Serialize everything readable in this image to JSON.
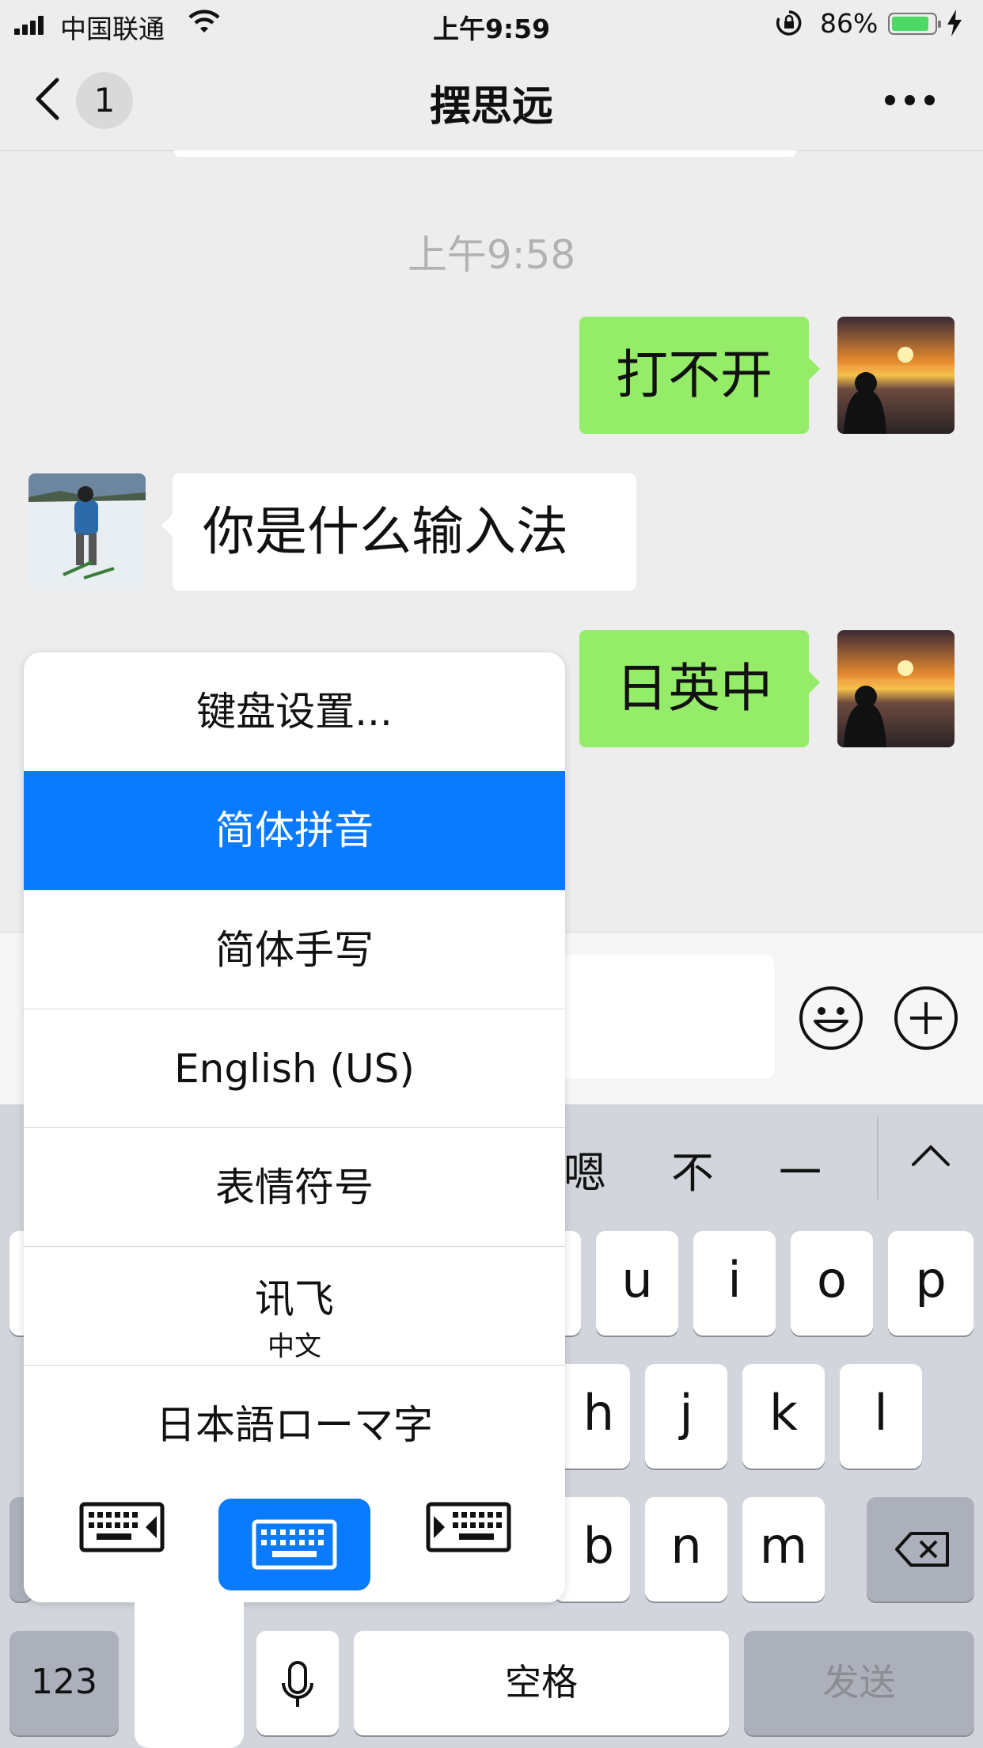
{
  "status_bar": {
    "carrier": "中国联通",
    "time": "上午9:59",
    "battery_percent": "86%",
    "battery_level": 0.86,
    "accent_green": "#4cd964"
  },
  "nav": {
    "back_icon": "chevron-left-icon",
    "unread_badge": "1",
    "title": "摆思远",
    "more_icon": "more-icon"
  },
  "chat": {
    "timestamp": "上午9:58",
    "messages": [
      {
        "side": "right",
        "text": "打不开"
      },
      {
        "side": "left",
        "text": "你是什么输入法"
      },
      {
        "side": "right",
        "text": "日英中"
      }
    ],
    "my_bubble_color": "#95ec69"
  },
  "input_bar": {
    "emoji_icon": "smiley-icon",
    "plus_icon": "plus-circle-icon"
  },
  "keyboard": {
    "candidates": [
      "嗯",
      "不",
      "一"
    ],
    "collapse_icon": "chevron-up-icon",
    "row1": [
      "u",
      "i",
      "o",
      "p"
    ],
    "row2": [
      "h",
      "j",
      "k",
      "l"
    ],
    "row3": [
      "b",
      "n",
      "m"
    ],
    "numbers_label": "123",
    "space_label": "空格",
    "send_label": "发送",
    "mic_icon": "microphone-icon",
    "backspace_icon": "backspace-icon"
  },
  "popup": {
    "items": [
      {
        "label": "键盘设置..."
      },
      {
        "label": "简体拼音",
        "selected": true
      },
      {
        "label": "简体手写"
      },
      {
        "label": "English (US)"
      },
      {
        "label": "表情符号"
      },
      {
        "label": "讯飞",
        "sublabel": "中文"
      },
      {
        "label": "日本語ローマ字"
      }
    ],
    "selected_color": "#0a7aff",
    "mode_icons": [
      "keyboard-left-icon",
      "keyboard-full-icon",
      "keyboard-right-icon"
    ]
  }
}
